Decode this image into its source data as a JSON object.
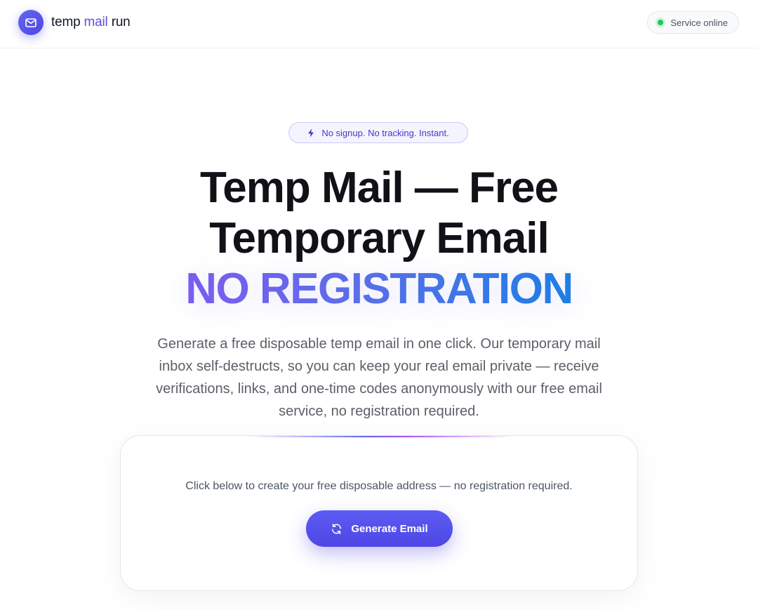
{
  "header": {
    "brand": {
      "logo_icon": "mail-icon",
      "name_part1": "temp",
      "name_part2": "mail",
      "name_part3": "run"
    },
    "status": {
      "label": "Service online",
      "dot_color": "#22c55e"
    }
  },
  "hero": {
    "badge": {
      "icon": "lightning-icon",
      "text": "No signup. No tracking. Instant."
    },
    "title_line1": "Temp Mail — Free",
    "title_line2": "Temporary Email",
    "title_highlight": "NO REGISTRATION",
    "description": "Generate a free disposable temp email in one click. Our temporary mail inbox self-destructs, so you can keep your real email private — receive verifications, links, and one-time codes anonymously with our free email service, no registration required."
  },
  "generator": {
    "prompt": "Click below to create your free disposable address — no registration required.",
    "button_label": "Generate Email",
    "button_icon": "refresh-icon"
  },
  "colors": {
    "accent": "#4f46e5",
    "gradient_start": "#7c5cf0",
    "gradient_end": "#1e7ee6"
  }
}
